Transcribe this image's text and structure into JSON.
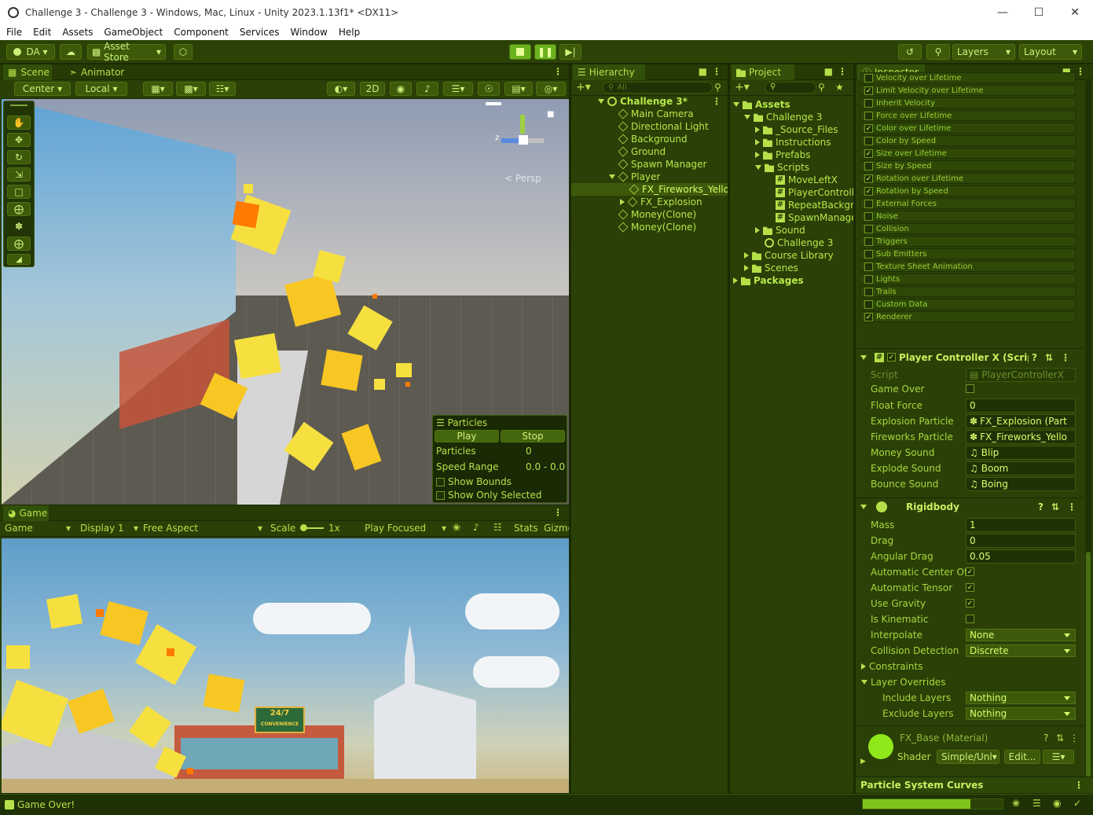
{
  "window": {
    "title": "Challenge 3 - Challenge 3 - Windows, Mac, Linux - Unity 2023.1.13f1* <DX11>"
  },
  "menu": [
    "File",
    "Edit",
    "Assets",
    "GameObject",
    "Component",
    "Services",
    "Window",
    "Help"
  ],
  "toolbar": {
    "account": "DA",
    "asset_store": "Asset Store",
    "layers": "Layers",
    "layout": "Layout"
  },
  "scene": {
    "tab_scene": "Scene",
    "tab_animator": "Animator",
    "pivot": "Center",
    "space": "Local",
    "mode2d": "2D",
    "persp": "Persp"
  },
  "particles": {
    "title": "Particles",
    "play": "Play",
    "stop": "Stop",
    "particles_label": "Particles",
    "particles_value": "0",
    "speed_label": "Speed Range",
    "speed_value": "0.0 - 0.0",
    "show_bounds": "Show Bounds",
    "show_selected": "Show Only Selected"
  },
  "game": {
    "tab": "Game",
    "view": "Game",
    "display": "Display 1",
    "aspect": "Free Aspect",
    "scale_label": "Scale",
    "scale_value": "1x",
    "play_focused": "Play Focused",
    "stats": "Stats",
    "gizmos": "Gizmo",
    "sign_top": "24/7",
    "sign_bottom": "CONVENIENCE"
  },
  "hierarchy": {
    "tab": "Hierarchy",
    "search": "All",
    "scene": "Challenge 3*",
    "items": [
      "Main Camera",
      "Directional Light",
      "Background",
      "Ground",
      "Spawn Manager",
      "Player",
      "FX_Fireworks_Yello",
      "FX_Explosion",
      "Money(Clone)",
      "Money(Clone)"
    ]
  },
  "project": {
    "tab": "Project",
    "items": [
      "Assets",
      "Challenge 3",
      "_Source_Files",
      "Instructions",
      "Prefabs",
      "Scripts",
      "MoveLeftX",
      "PlayerControlle",
      "RepeatBackgro",
      "SpawnManage",
      "Sound",
      "Challenge 3",
      "Course Library",
      "Scenes",
      "Packages"
    ]
  },
  "inspector": {
    "tab": "Inspector",
    "modules": [
      {
        "label": "Velocity over Lifetime",
        "on": false
      },
      {
        "label": "Limit Velocity over Lifetime",
        "on": true
      },
      {
        "label": "Inherit Velocity",
        "on": false
      },
      {
        "label": "Force over Lifetime",
        "on": false
      },
      {
        "label": "Color over Lifetime",
        "on": true
      },
      {
        "label": "Color by Speed",
        "on": false
      },
      {
        "label": "Size over Lifetime",
        "on": true
      },
      {
        "label": "Size by Speed",
        "on": false
      },
      {
        "label": "Rotation over Lifetime",
        "on": true
      },
      {
        "label": "Rotation by Speed",
        "on": true
      },
      {
        "label": "External Forces",
        "on": false
      },
      {
        "label": "Noise",
        "on": false
      },
      {
        "label": "Collision",
        "on": false
      },
      {
        "label": "Triggers",
        "on": false
      },
      {
        "label": "Sub Emitters",
        "on": false
      },
      {
        "label": "Texture Sheet Animation",
        "on": false
      },
      {
        "label": "Lights",
        "on": false
      },
      {
        "label": "Trails",
        "on": false
      },
      {
        "label": "Custom Data",
        "on": false
      },
      {
        "label": "Renderer",
        "on": true
      }
    ],
    "pcx": {
      "title": "Player Controller X (Scrip",
      "script_label": "Script",
      "script_value": "PlayerControllerX",
      "game_over": "Game Over",
      "float_force": "Float Force",
      "float_force_value": "0",
      "explosion": "Explosion Particle",
      "explosion_value": "FX_Explosion (Part",
      "fireworks": "Fireworks Particle",
      "fireworks_value": "FX_Fireworks_Yello",
      "money": "Money Sound",
      "money_value": "Blip",
      "explode": "Explode Sound",
      "explode_value": "Boom",
      "bounce": "Bounce Sound",
      "bounce_value": "Boing"
    },
    "rb": {
      "title": "Rigidbody",
      "mass": "Mass",
      "mass_value": "1",
      "drag": "Drag",
      "drag_value": "0",
      "angular": "Angular Drag",
      "angular_value": "0.05",
      "auto_com": "Automatic Center Of",
      "auto_tensor": "Automatic Tensor",
      "gravity": "Use Gravity",
      "kinematic": "Is Kinematic",
      "interpolate": "Interpolate",
      "interpolate_value": "None",
      "collision": "Collision Detection",
      "collision_value": "Discrete",
      "constraints": "Constraints",
      "overrides": "Layer Overrides",
      "include": "Include Layers",
      "include_value": "Nothing",
      "exclude": "Exclude Layers",
      "exclude_value": "Nothing"
    },
    "material": {
      "name": "FX_Base (Material)",
      "shader_label": "Shader",
      "shader_value": "Simple/Unl",
      "edit": "Edit..."
    },
    "curves": "Particle System Curves"
  },
  "status": {
    "message": "Game Over!",
    "progress": 0.77
  },
  "colors": {
    "accent": "#b6e04a",
    "panel": "#2a4006",
    "background": "#1a2a04"
  }
}
